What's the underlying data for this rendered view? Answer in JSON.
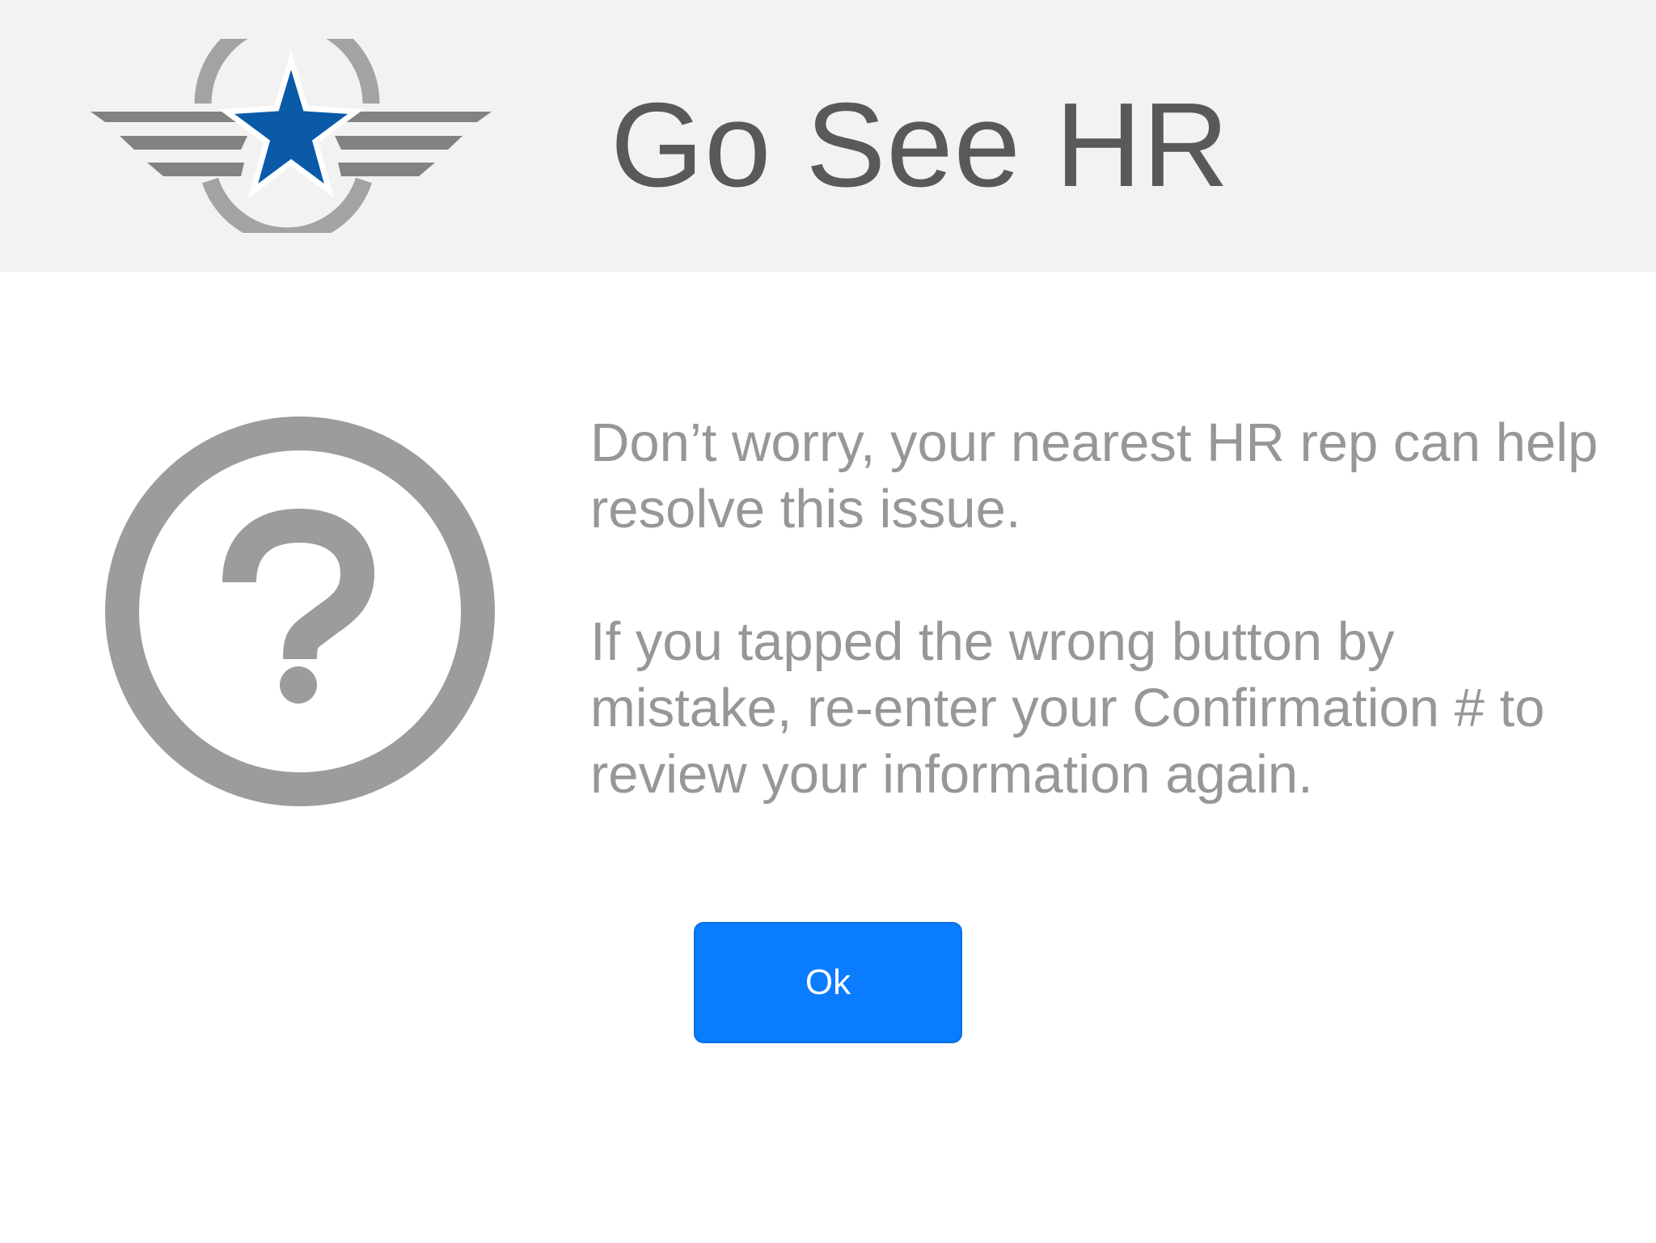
{
  "header": {
    "title": "Go See HR",
    "logo_icon": "winged-star-logo"
  },
  "main": {
    "icon": "question-circle-icon",
    "message_paragraph_1": "Don’t worry, your nearest HR rep can help resolve this issue.",
    "message_paragraph_2": "If you tapped the wrong button by mistake, re-enter your Confirmation # to review your information again.",
    "ok_label": "Ok"
  },
  "colors": {
    "header_background": "#f2f2f2",
    "title_text": "#595959",
    "body_text": "#979797",
    "icon_gray": "#9c9c9c",
    "logo_star_blue": "#0a5aa8",
    "button_blue": "#0a7cff"
  }
}
